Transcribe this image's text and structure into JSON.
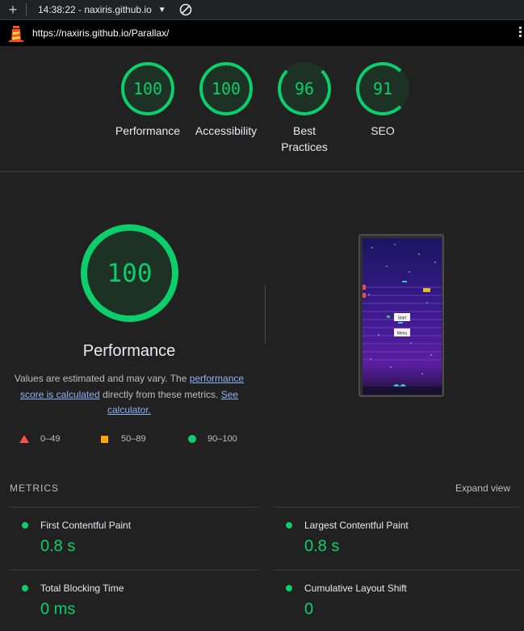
{
  "topbar": {
    "time_host": "14:38:22 - naxiris.github.io"
  },
  "urlbar": {
    "url": "https://naxiris.github.io/Parallax/"
  },
  "gauges": [
    {
      "score": "100",
      "label": "Performance"
    },
    {
      "score": "100",
      "label": "Accessibility"
    },
    {
      "score": "96",
      "label": "Best Practices",
      "label_line1": "Best",
      "label_line2": "Practices"
    },
    {
      "score": "91",
      "label": "SEO"
    }
  ],
  "performance": {
    "score": "100",
    "title": "Performance",
    "desc_prefix": "Values are estimated and may vary. The ",
    "desc_link1": "performance score is calculated",
    "desc_mid": " directly from these metrics. ",
    "desc_link2": "See calculator."
  },
  "legend": {
    "fail": "0–49",
    "average": "50–89",
    "pass": "90–100"
  },
  "screenshot": {
    "start_button": "Start",
    "menu_button": "Menu"
  },
  "metrics": {
    "title": "METRICS",
    "expand_label": "Expand view",
    "items": [
      {
        "name": "First Contentful Paint",
        "value": "0.8 s"
      },
      {
        "name": "Largest Contentful Paint",
        "value": "0.8 s"
      },
      {
        "name": "Total Blocking Time",
        "value": "0 ms"
      },
      {
        "name": "Cumulative Layout Shift",
        "value": "0"
      }
    ]
  },
  "colors": {
    "pass": "#0cce6b",
    "average": "#ffa400",
    "fail": "#ff4e42",
    "link": "#8ab4f8"
  }
}
